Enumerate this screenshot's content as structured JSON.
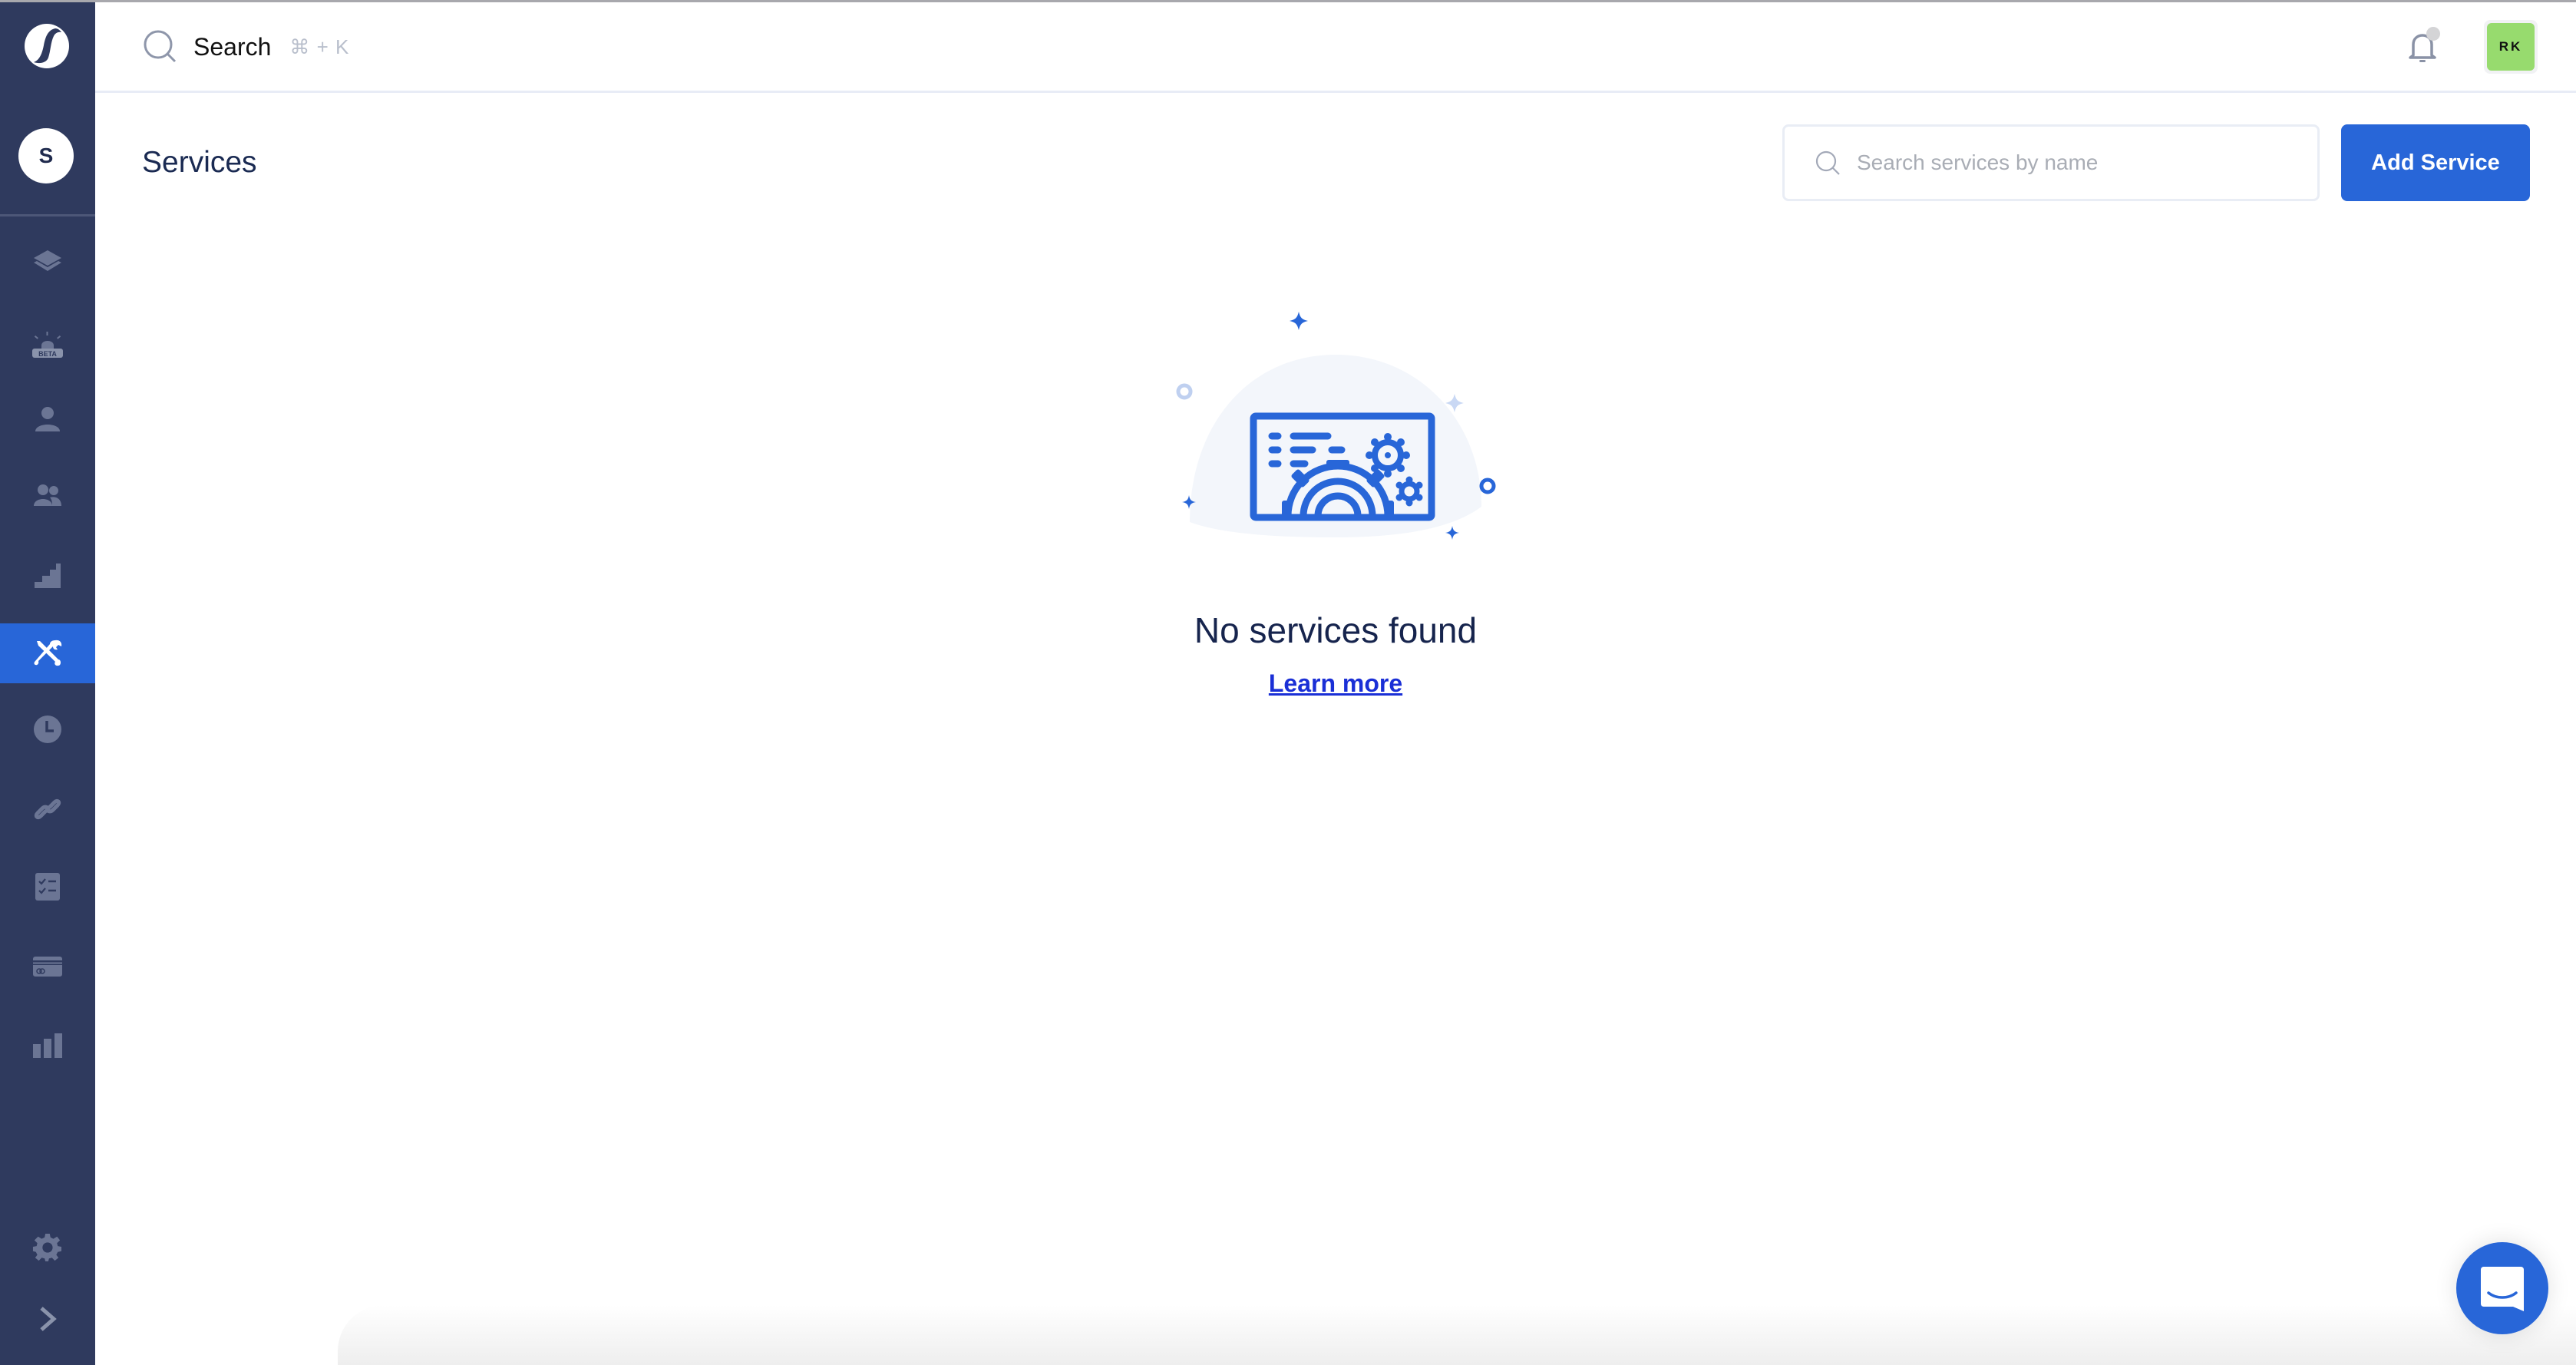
{
  "app": {
    "org_initial": "S",
    "user_initials": "RK",
    "accent_color": "#2866d8",
    "sidebar_color": "#2f3a5e"
  },
  "sidebar": {
    "items": [
      {
        "id": "layers",
        "icon": "layers-icon",
        "active": false
      },
      {
        "id": "incidents-beta",
        "icon": "siren-beta-icon",
        "badge": "BETA",
        "active": false
      },
      {
        "id": "user",
        "icon": "user-icon",
        "active": false
      },
      {
        "id": "teams",
        "icon": "users-icon",
        "active": false
      },
      {
        "id": "escalations",
        "icon": "stairs-icon",
        "active": false
      },
      {
        "id": "services",
        "icon": "tools-icon",
        "active": true
      },
      {
        "id": "schedules",
        "icon": "clock-icon",
        "active": false
      },
      {
        "id": "integrations",
        "icon": "link-icon",
        "active": false
      },
      {
        "id": "checklists",
        "icon": "checklist-icon",
        "active": false
      },
      {
        "id": "billing",
        "icon": "credit-card-icon",
        "active": false
      },
      {
        "id": "analytics",
        "icon": "bar-chart-icon",
        "active": false
      }
    ],
    "settings_icon": "gear-icon",
    "expand_icon": "chevron-right-icon"
  },
  "header": {
    "search_label": "Search",
    "search_shortcut": "⌘ + K"
  },
  "main": {
    "title": "Services",
    "search_placeholder": "Search services by name",
    "search_value": "",
    "add_button_label": "Add Service",
    "empty_state": {
      "title": "No services found",
      "link_label": "Learn more"
    }
  }
}
